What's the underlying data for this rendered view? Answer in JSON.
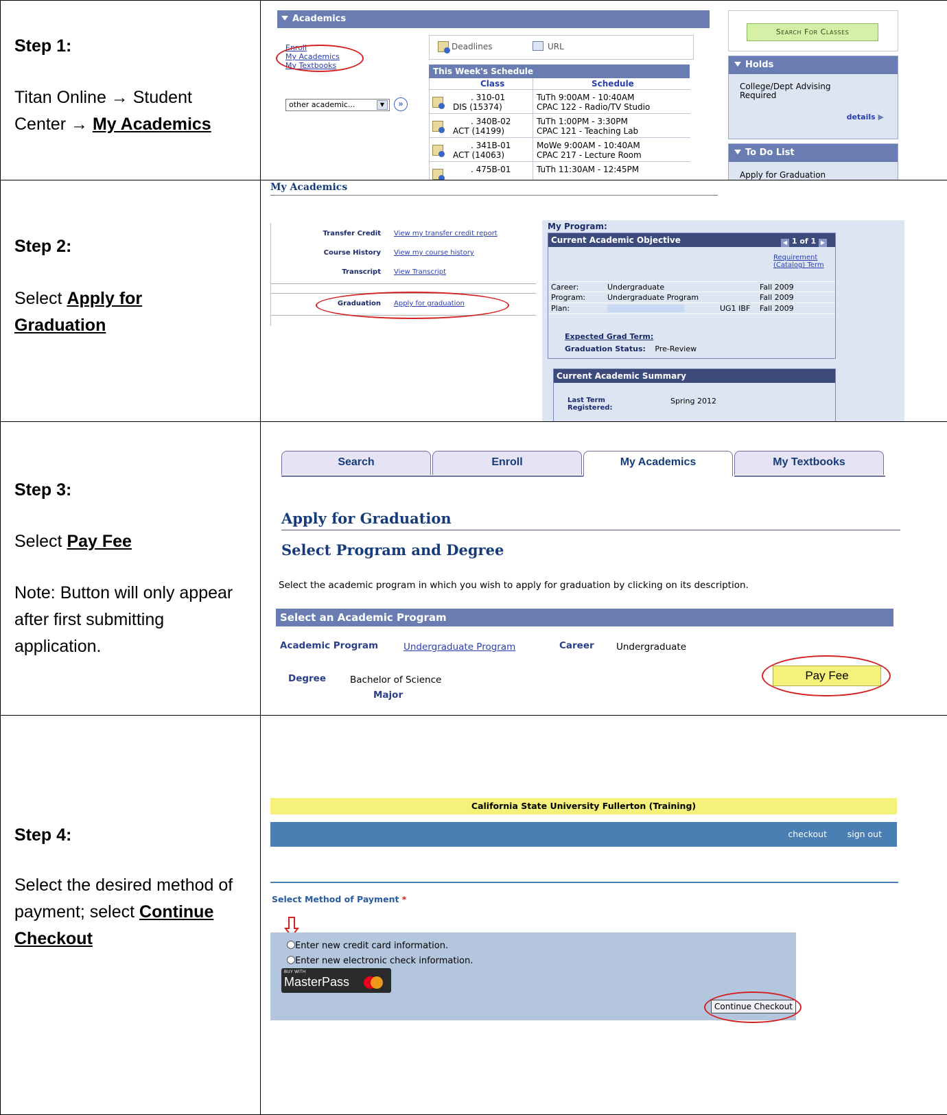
{
  "steps": [
    {
      "num": "Step 1:",
      "text1": "Titan Online → Student Center → ",
      "bold": "My Academics"
    },
    {
      "num": "Step 2:",
      "pre": "Select ",
      "bold": "Apply for Graduation"
    },
    {
      "num": "Step 3:",
      "pre": "Select ",
      "bold": "Pay Fee",
      "note": "Note: Button will only appear after first submitting application."
    },
    {
      "num": "Step 4:",
      "pre": "Select the desired method of payment; select ",
      "bold": "Continue Checkout"
    }
  ],
  "s1": {
    "header": "Academics",
    "links": [
      "Enroll",
      "My Academics",
      "My Textbooks"
    ],
    "dropdown": "other academic...",
    "deadlines": "Deadlines",
    "url": "URL",
    "schedule_title": "This Week's Schedule",
    "col_class": "Class",
    "col_schedule": "Schedule",
    "rows": [
      {
        "c1": ". 310-01",
        "c2": "DIS (15374)",
        "s1": "TuTh 9:00AM - 10:40AM",
        "s2": "CPAC 122 - Radio/TV Studio"
      },
      {
        "c1": ". 340B-02",
        "c2": "ACT (14199)",
        "s1": "TuTh 1:00PM - 3:30PM",
        "s2": "CPAC 121 - Teaching Lab"
      },
      {
        "c1": ". 341B-01",
        "c2": "ACT (14063)",
        "s1": "MoWe 9:00AM - 10:40AM",
        "s2": "CPAC 217 - Lecture Room"
      },
      {
        "c1": ". 475B-01",
        "c2": "",
        "s1": "TuTh 11:30AM - 12:45PM",
        "s2": ""
      }
    ],
    "search_btn": "Search For Classes",
    "holds": "Holds",
    "holds_text": "College/Dept Advising Required",
    "details": "details",
    "todo": "To Do List",
    "todo_item": "Apply for Graduation"
  },
  "s2": {
    "title": "My Academics",
    "rows": [
      {
        "label": "Transfer Credit",
        "link": "View my transfer credit report"
      },
      {
        "label": "Course History",
        "link": "View my course history"
      },
      {
        "label": "Transcript",
        "link": "View Transcript"
      }
    ],
    "grad_label": "Graduation",
    "grad_link": "Apply for graduation",
    "program_label": "My Program:",
    "objective": "Current Academic Objective",
    "pager": "1 of 1",
    "req_term": "Requirement (Catalog) Term",
    "career_l": "Career:",
    "career_v": "Undergraduate",
    "career_t": "Fall 2009",
    "program_l": "Program:",
    "program_v": "Undergraduate Program",
    "program_t": "Fall 2009",
    "plan_l": "Plan:",
    "plan_code": "UG1 IBF",
    "plan_t": "Fall 2009",
    "exp_grad": "Expected Grad Term:",
    "grad_status_l": "Graduation Status:",
    "grad_status_v": "Pre-Review",
    "summary": "Current Academic Summary",
    "last_term_l": "Last Term Registered:",
    "last_term_v": "Spring 2012"
  },
  "s3": {
    "tabs": [
      "Search",
      "Enroll",
      "My Academics",
      "My Textbooks"
    ],
    "h1": "Apply for Graduation",
    "h2": "Select Program and Degree",
    "instr": "Select the academic program in which you wish to apply for graduation by clicking on its description.",
    "bar": "Select an Academic Program",
    "ap_l": "Academic Program",
    "ap_v": "Undergraduate Program",
    "career_l": "Career",
    "career_v": "Undergraduate",
    "degree_l": "Degree",
    "degree_v": "Bachelor of Science",
    "major_l": "Major",
    "pay_btn": "Pay Fee"
  },
  "s4": {
    "banner": "California State University Fullerton (Training)",
    "nav": [
      "checkout",
      "sign out"
    ],
    "method_label": "Select Method of Payment",
    "req": "*",
    "opt1": "Enter new credit card information.",
    "opt2": "Enter new electronic check information.",
    "mp_small": "BUY WITH",
    "mp_big": "MasterPass",
    "continue_btn": "Continue Checkout"
  },
  "colors": {
    "accent_blue": "#6a7db3",
    "dark_blue": "#3d4a7c",
    "yellow": "#f4f27a",
    "red": "#d42020",
    "steel_blue": "#4a7fb4",
    "panel": "#b4c6de"
  }
}
